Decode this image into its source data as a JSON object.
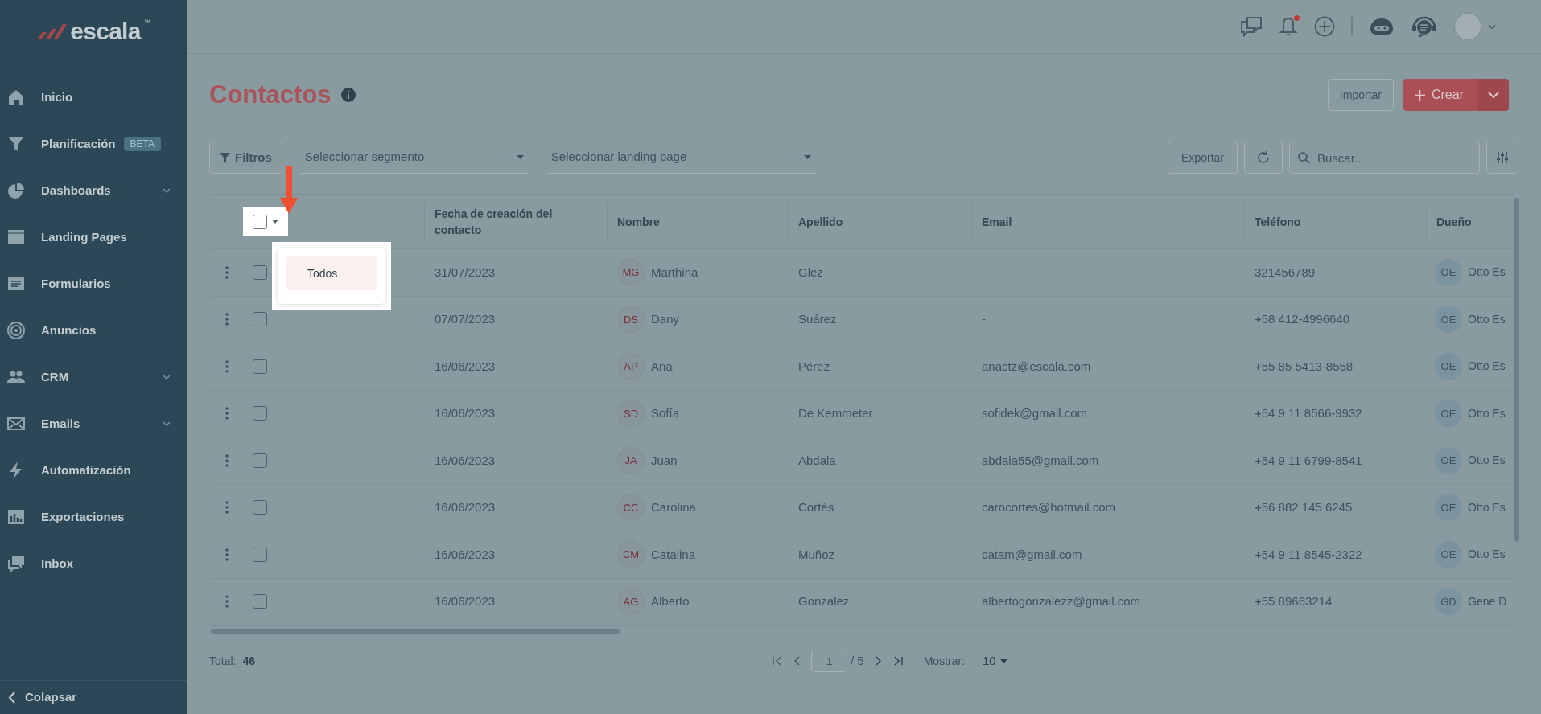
{
  "header": {
    "notifications_unread": true
  },
  "sidebar": {
    "logo": "escala",
    "trademark": "™",
    "items": [
      {
        "label": "Inicio",
        "expandable": false
      },
      {
        "label": "Planificación",
        "badge": "BETA",
        "expandable": false
      },
      {
        "label": "Dashboards",
        "expandable": true
      },
      {
        "label": "Landing Pages",
        "expandable": false
      },
      {
        "label": "Formularios",
        "expandable": false
      },
      {
        "label": "Anuncios",
        "expandable": false
      },
      {
        "label": "CRM",
        "expandable": true
      },
      {
        "label": "Emails",
        "expandable": true
      },
      {
        "label": "Automatización",
        "expandable": false
      },
      {
        "label": "Exportaciones",
        "expandable": false
      },
      {
        "label": "Inbox",
        "expandable": false
      }
    ],
    "collapse": "Colapsar"
  },
  "page": {
    "title": "Contactos",
    "import": "Importar",
    "create": "Crear"
  },
  "filters": {
    "button": "Filtros",
    "segment_placeholder": "Seleccionar segmento",
    "landing_placeholder": "Seleccionar landing page",
    "export": "Exportar",
    "search_placeholder": "Buscar..."
  },
  "table": {
    "columns": [
      "Fecha de creación del contacto",
      "Nombre",
      "Apellido",
      "Email",
      "Teléfono",
      "Dueño"
    ],
    "select_all": {
      "checked": false,
      "menu_open": true,
      "menu": [
        {
          "label": "Todos",
          "selected": true
        }
      ]
    },
    "rows": [
      {
        "checked": false,
        "date": "31/07/2023",
        "initials": "MG",
        "name": "Marthina",
        "surname": "Glez",
        "email": "-",
        "phone": "321456789",
        "owner_initials": "OE",
        "owner": "Otto Es"
      },
      {
        "checked": false,
        "date": "07/07/2023",
        "initials": "DS",
        "name": "Dany",
        "surname": "Suárez",
        "email": "-",
        "phone": "+58 412-4996640",
        "owner_initials": "OE",
        "owner": "Otto Es"
      },
      {
        "checked": false,
        "date": "16/06/2023",
        "initials": "AP",
        "name": "Ana",
        "surname": "Pérez",
        "email": "anactz@escala.com",
        "phone": "+55 85 5413-8558",
        "owner_initials": "OE",
        "owner": "Otto Es"
      },
      {
        "checked": false,
        "date": "16/06/2023",
        "initials": "SD",
        "name": "Sofía",
        "surname": "De Kemmeter",
        "email": "sofidek@gmail.com",
        "phone": "+54 9 11 8566-9932",
        "owner_initials": "OE",
        "owner": "Otto Es"
      },
      {
        "checked": false,
        "date": "16/06/2023",
        "initials": "JA",
        "name": "Juan",
        "surname": "Abdala",
        "email": "abdala55@gmail.com",
        "phone": "+54 9 11 6799-8541",
        "owner_initials": "OE",
        "owner": "Otto Es"
      },
      {
        "checked": false,
        "date": "16/06/2023",
        "initials": "CC",
        "name": "Carolina",
        "surname": "Cortés",
        "email": "carocortes@hotmail.com",
        "phone": "+56 882 145 6245",
        "owner_initials": "OE",
        "owner": "Otto Es"
      },
      {
        "checked": false,
        "date": "16/06/2023",
        "initials": "CM",
        "name": "Catalina",
        "surname": "Muñoz",
        "email": "catam@gmail.com",
        "phone": "+54 9 11 8545-2322",
        "owner_initials": "OE",
        "owner": "Otto Es"
      },
      {
        "checked": false,
        "date": "16/06/2023",
        "initials": "AG",
        "name": "Alberto",
        "surname": "González",
        "email": "albertogonzalezz@gmail.com",
        "phone": "+55 89663214",
        "owner_initials": "GD",
        "owner": "Gene D"
      }
    ]
  },
  "footer": {
    "total_label": "Total:",
    "total": "46",
    "page": "1",
    "pages": "/ 5",
    "show_label": "Mostrar:",
    "page_size": "10"
  }
}
